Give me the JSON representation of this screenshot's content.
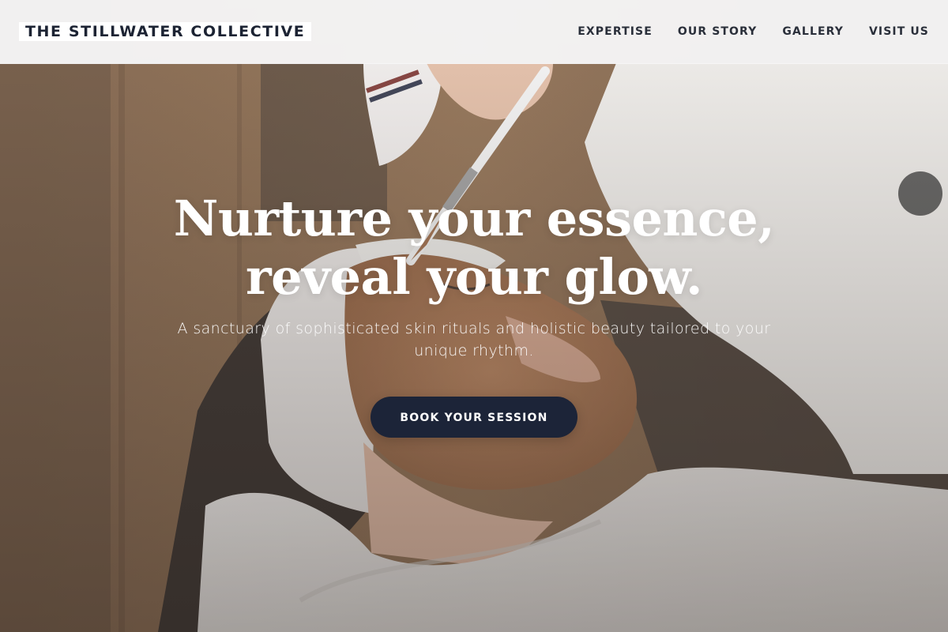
{
  "header": {
    "brand": "THE STILLWATER COLLECTIVE",
    "nav": [
      {
        "label": "EXPERTISE"
      },
      {
        "label": "OUR STORY"
      },
      {
        "label": "GALLERY"
      },
      {
        "label": "VISIT US"
      }
    ]
  },
  "hero": {
    "title_line1": "Nurture your essence,",
    "title_line2": "reveal your glow.",
    "subtitle": "A sanctuary of sophisticated skin rituals and holistic beauty tailored to your unique rhythm.",
    "cta_label": "BOOK YOUR SESSION",
    "image_icon": "spa-facial-photo"
  },
  "colors": {
    "brand_text": "#1c2333",
    "cta_bg": "#1c2438",
    "header_bg": "#f6f6f7",
    "hero_text": "#ffffff"
  }
}
